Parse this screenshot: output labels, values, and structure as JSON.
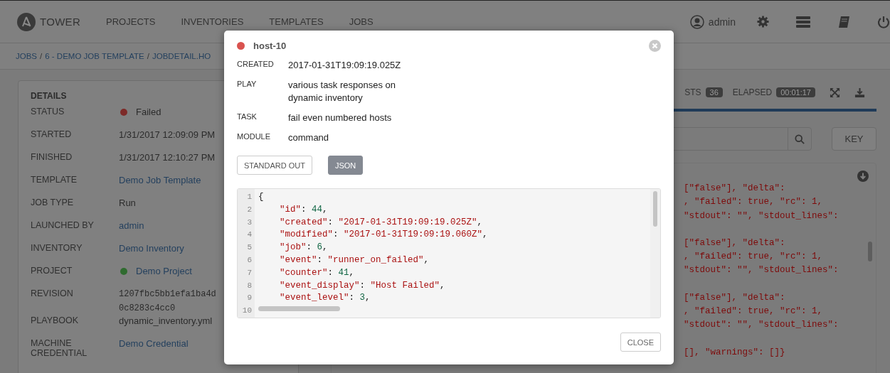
{
  "nav": {
    "brand": "TOWER",
    "links": [
      {
        "label": "PROJECTS"
      },
      {
        "label": "INVENTORIES"
      },
      {
        "label": "TEMPLATES"
      },
      {
        "label": "JOBS"
      }
    ],
    "user": "admin"
  },
  "breadcrumb": {
    "separator": "/",
    "items": [
      "JOBS",
      "6 - DEMO JOB TEMPLATE",
      "JOBDETAIL.HO"
    ]
  },
  "details": {
    "title": "DETAILS",
    "rows": [
      {
        "label": "STATUS",
        "value": "Failed",
        "kind": "text",
        "color": "#7d2a28"
      },
      {
        "label": "STARTED",
        "value": "1/31/2017 12:09:09 PM",
        "kind": "text"
      },
      {
        "label": "FINISHED",
        "value": "1/31/2017 12:10:27 PM",
        "kind": "text"
      },
      {
        "label": "TEMPLATE",
        "value": "Demo Job Template",
        "kind": "link"
      },
      {
        "label": "JOB TYPE",
        "value": "Run",
        "kind": "text"
      },
      {
        "label": "LAUNCHED BY",
        "value": "admin",
        "kind": "link"
      },
      {
        "label": "INVENTORY",
        "value": "Demo Inventory",
        "kind": "link"
      },
      {
        "label": "PROJECT",
        "value": "Demo Project",
        "kind": "link",
        "color": "#2f6b2f"
      },
      {
        "label": "REVISION",
        "value": "1207fbc5bb1efa1ba4d 0c8283c4cc0",
        "kind": "mono"
      },
      {
        "label": "PLAYBOOK",
        "value": "dynamic_inventory.yml",
        "kind": "text"
      },
      {
        "label": "MACHINE CREDENTIAL",
        "value": "Demo Credential",
        "kind": "link"
      }
    ]
  },
  "job_output": {
    "hosts_label": "STS",
    "hosts_count": "36",
    "elapsed_label": "ELAPSED",
    "elapsed": "00:01:17",
    "key_button": "KEY",
    "line_groups": [
      [
        "[\"false\"], \"delta\":",
        ", \"failed\": true, \"rc\": 1,",
        "\"stdout\": \"\", \"stdout_lines\":"
      ],
      [
        "[\"false\"], \"delta\":",
        ", \"failed\": true, \"rc\": 1,",
        "\"stdout\": \"\", \"stdout_lines\":"
      ],
      [
        "[\"false\"], \"delta\":",
        ", \"failed\": true, \"rc\": 1,",
        "\"stdout\": \"\", \"stdout_lines\":"
      ],
      [
        "[], \"warnings\": []}"
      ]
    ]
  },
  "modal": {
    "host": {
      "name": "host-10",
      "color": "#d9534f"
    },
    "fields": [
      {
        "label": "CREATED",
        "value": "2017-01-31T19:09:19.025Z"
      },
      {
        "label": "PLAY",
        "value": "various task responses on dynamic inventory"
      },
      {
        "label": "TASK",
        "value": "fail even numbered hosts"
      },
      {
        "label": "MODULE",
        "value": "command"
      }
    ],
    "tabs": [
      {
        "label": "STANDARD OUT",
        "selected": false
      },
      {
        "label": "JSON",
        "selected": true
      }
    ],
    "line_numbers": [
      "1",
      "2",
      "3",
      "4",
      "5",
      "6",
      "7",
      "8",
      "9",
      "10"
    ],
    "code": [
      {
        "indented": false,
        "parts": [
          {
            "kind": "punct",
            "text": "{"
          }
        ]
      },
      {
        "indented": true,
        "parts": [
          {
            "kind": "string",
            "text": "\"id\""
          },
          {
            "kind": "punct",
            "text": ": "
          },
          {
            "kind": "number",
            "text": "44"
          },
          {
            "kind": "punct",
            "text": ","
          }
        ]
      },
      {
        "indented": true,
        "parts": [
          {
            "kind": "string",
            "text": "\"created\""
          },
          {
            "kind": "punct",
            "text": ": "
          },
          {
            "kind": "string",
            "text": "\"2017-01-31T19:09:19.025Z\""
          },
          {
            "kind": "punct",
            "text": ","
          }
        ]
      },
      {
        "indented": true,
        "parts": [
          {
            "kind": "string",
            "text": "\"modified\""
          },
          {
            "kind": "punct",
            "text": ": "
          },
          {
            "kind": "string",
            "text": "\"2017-01-31T19:09:19.060Z\""
          },
          {
            "kind": "punct",
            "text": ","
          }
        ]
      },
      {
        "indented": true,
        "parts": [
          {
            "kind": "string",
            "text": "\"job\""
          },
          {
            "kind": "punct",
            "text": ": "
          },
          {
            "kind": "number",
            "text": "6"
          },
          {
            "kind": "punct",
            "text": ","
          }
        ]
      },
      {
        "indented": true,
        "parts": [
          {
            "kind": "string",
            "text": "\"event\""
          },
          {
            "kind": "punct",
            "text": ": "
          },
          {
            "kind": "string",
            "text": "\"runner_on_failed\""
          },
          {
            "kind": "punct",
            "text": ","
          }
        ]
      },
      {
        "indented": true,
        "parts": [
          {
            "kind": "string",
            "text": "\"counter\""
          },
          {
            "kind": "punct",
            "text": ": "
          },
          {
            "kind": "number",
            "text": "41"
          },
          {
            "kind": "punct",
            "text": ","
          }
        ]
      },
      {
        "indented": true,
        "parts": [
          {
            "kind": "string",
            "text": "\"event_display\""
          },
          {
            "kind": "punct",
            "text": ": "
          },
          {
            "kind": "string",
            "text": "\"Host Failed\""
          },
          {
            "kind": "punct",
            "text": ","
          }
        ]
      },
      {
        "indented": true,
        "parts": [
          {
            "kind": "string",
            "text": "\"event_level\""
          },
          {
            "kind": "punct",
            "text": ": "
          },
          {
            "kind": "number",
            "text": "3"
          },
          {
            "kind": "punct",
            "text": ","
          }
        ]
      }
    ],
    "close_button": "CLOSE"
  }
}
